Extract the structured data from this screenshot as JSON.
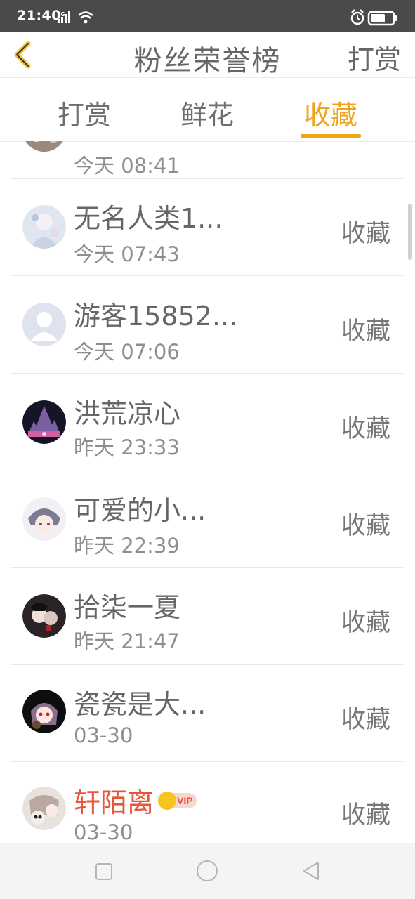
{
  "status_bar": {
    "time": "21:40",
    "network": "4G",
    "icons": [
      "signal-icon",
      "wifi-icon",
      "alarm-icon",
      "battery-icon"
    ]
  },
  "navbar": {
    "back_icon": "chevron-left-icon",
    "title": "粉丝荣誉榜",
    "action": "打赏"
  },
  "tabs": [
    {
      "label": "打赏",
      "active": false
    },
    {
      "label": "鲜花",
      "active": false
    },
    {
      "label": "收藏",
      "active": true
    }
  ],
  "colors": {
    "accent": "#f0a21a",
    "vip_name": "#e8553a",
    "status_bar": "#4a4a4a"
  },
  "list": {
    "partial_top_time": "今天 08:41",
    "items": [
      {
        "name": "无名人类1...",
        "time": "今天 07:43",
        "type": "收藏",
        "vip": false
      },
      {
        "name": "游客15852...",
        "time": "今天 07:06",
        "type": "收藏",
        "vip": false
      },
      {
        "name": "洪荒凉心",
        "time": "昨天 23:33",
        "type": "收藏",
        "vip": false
      },
      {
        "name": "可爱的小...",
        "time": "昨天 22:39",
        "type": "收藏",
        "vip": false
      },
      {
        "name": "拾柒一夏",
        "time": "昨天 21:47",
        "type": "收藏",
        "vip": false
      },
      {
        "name": "瓷瓷是大...",
        "time": "03-30",
        "type": "收藏",
        "vip": false
      },
      {
        "name": "轩陌离",
        "time": "03-30",
        "type": "收藏",
        "vip": true,
        "badge": "VIP"
      }
    ]
  },
  "bottom_nav": {
    "icons": [
      "square-icon",
      "circle-icon",
      "triangle-back-icon"
    ]
  }
}
